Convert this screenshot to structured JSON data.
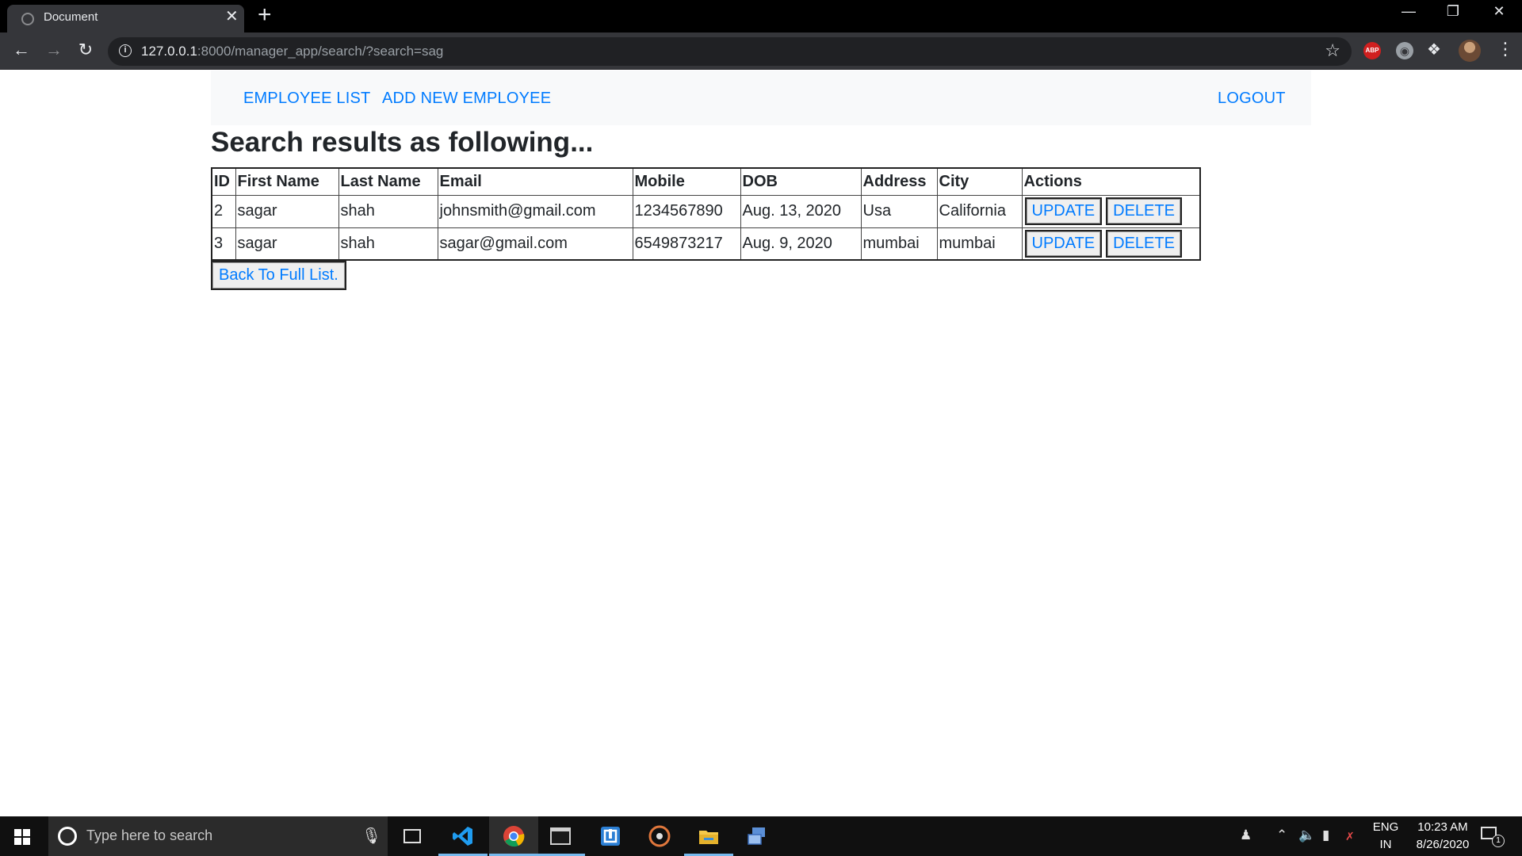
{
  "browser": {
    "tab_title": "Document",
    "tab_close": "✕",
    "new_tab": "+",
    "url_host": "127.0.0.1",
    "url_rest": ":8000/manager_app/search/?search=sag",
    "abp_label": "ABP"
  },
  "navbar": {
    "employee_list": "EMPLOYEE LIST",
    "add_new_employee": "ADD NEW EMPLOYEE",
    "logout": "LOGOUT"
  },
  "page": {
    "heading": "Search results as following..."
  },
  "table": {
    "headers": [
      "ID",
      "First Name",
      "Last Name",
      "Email",
      "Mobile",
      "DOB",
      "Address",
      "City",
      "Actions"
    ],
    "rows": [
      {
        "id": "2",
        "first_name": "sagar",
        "last_name": "shah",
        "email": "johnsmith@gmail.com",
        "mobile": "1234567890",
        "dob": "Aug. 13, 2020",
        "address": "Usa",
        "city": "California"
      },
      {
        "id": "3",
        "first_name": "sagar",
        "last_name": "shah",
        "email": "sagar@gmail.com",
        "mobile": "6549873217",
        "dob": "Aug. 9, 2020",
        "address": "mumbai",
        "city": "mumbai"
      }
    ],
    "update_label": "UPDATE",
    "delete_label": "DELETE"
  },
  "back_button": "Back To Full List.",
  "taskbar": {
    "search_placeholder": "Type here to search",
    "language": "ENG",
    "region": "IN",
    "time": "10:23 AM",
    "date": "8/26/2020",
    "notification_count": "1"
  },
  "colors": {
    "link": "#007bff",
    "navbar_bg": "#f8f9fa",
    "chrome_bg": "#35363a",
    "taskbar_bg": "#101010"
  }
}
